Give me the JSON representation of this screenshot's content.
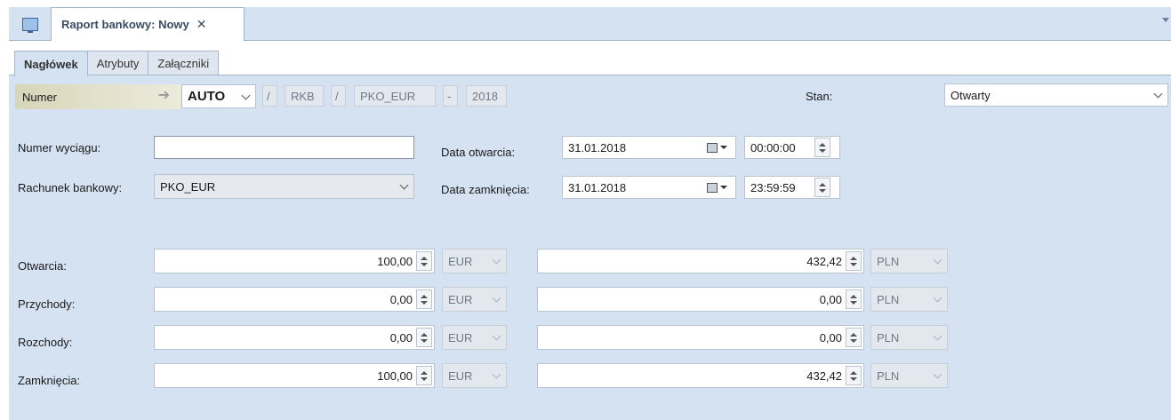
{
  "document_tab": {
    "title": "Raport bankowy: Nowy",
    "close_glyph": "✕",
    "app_icon": "monitor-icon"
  },
  "tabs": [
    {
      "label": "Nagłówek",
      "active": true
    },
    {
      "label": "Atrybuty",
      "active": false
    },
    {
      "label": "Załączniki",
      "active": false
    }
  ],
  "numer": {
    "label": "Numer",
    "arrow": "➔",
    "auto": "AUTO",
    "sep1": "/",
    "rkb": "RKB",
    "sep2": "/",
    "account": "PKO_EUR",
    "dash": "-",
    "year": "2018"
  },
  "stan": {
    "label": "Stan:",
    "value": "Otwarty"
  },
  "fields": {
    "numer_wyciagu_label": "Numer wyciągu:",
    "numer_wyciagu_value": "",
    "rachunek_label": "Rachunek bankowy:",
    "rachunek_value": "PKO_EUR",
    "data_otwarcia_label": "Data otwarcia:",
    "data_otwarcia_date": "31.01.2018",
    "data_otwarcia_time": "00:00:00",
    "data_zamkniecia_label": "Data zamknięcia:",
    "data_zamkniecia_date": "31.01.2018",
    "data_zamkniecia_time": "23:59:59"
  },
  "amounts": [
    {
      "label": "Otwarcia:",
      "value": "100,00",
      "currency": "EUR",
      "value_pln": "432,42",
      "currency_pln": "PLN"
    },
    {
      "label": "Przychody:",
      "value": "0,00",
      "currency": "EUR",
      "value_pln": "0,00",
      "currency_pln": "PLN"
    },
    {
      "label": "Rozchody:",
      "value": "0,00",
      "currency": "EUR",
      "value_pln": "0,00",
      "currency_pln": "PLN"
    },
    {
      "label": "Zamknięcia:",
      "value": "100,00",
      "currency": "EUR",
      "value_pln": "432,42",
      "currency_pln": "PLN"
    }
  ],
  "colors": {
    "panel_bg": "#d5e2f1",
    "tab_bg": "#ffffff",
    "numer_label_bg": "#d8d6b8"
  }
}
